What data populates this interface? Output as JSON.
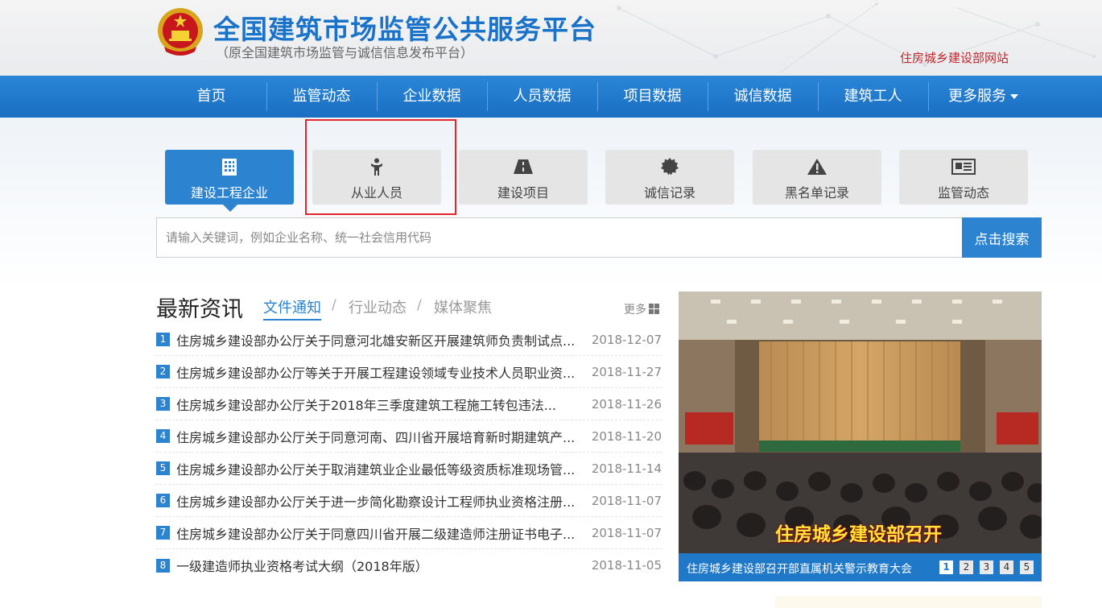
{
  "header": {
    "title": "全国建筑市场监管公共服务平台",
    "subtitle": "（原全国建筑市场监管与诚信信息发布平台）",
    "ministry_link": "住房城乡建设部网站"
  },
  "nav": {
    "items": [
      "首页",
      "监管动态",
      "企业数据",
      "人员数据",
      "项目数据",
      "诚信数据",
      "建筑工人"
    ],
    "more_label": "更多服务"
  },
  "tabs": [
    {
      "label": "建设工程企业",
      "icon": "building-icon",
      "active": true
    },
    {
      "label": "从业人员",
      "icon": "person-icon",
      "active": false
    },
    {
      "label": "建设项目",
      "icon": "road-icon",
      "active": false
    },
    {
      "label": "诚信记录",
      "icon": "badge-icon",
      "active": false
    },
    {
      "label": "黑名单记录",
      "icon": "warning-icon",
      "active": false
    },
    {
      "label": "监管动态",
      "icon": "newspaper-icon",
      "active": false
    }
  ],
  "search": {
    "placeholder": "请输入关键词，例如企业名称、统一社会信用代码",
    "button_label": "点击搜索"
  },
  "news": {
    "heading": "最新资讯",
    "tabs": [
      "文件通知",
      "行业动态",
      "媒体聚焦"
    ],
    "separator": "/",
    "more_label": "更多",
    "items": [
      {
        "num": "1",
        "title": "住房城乡建设部办公厅关于同意河北雄安新区开展建筑师负责制试点...",
        "date": "2018-12-07"
      },
      {
        "num": "2",
        "title": "住房城乡建设部办公厅等关于开展工程建设领域专业技术人员职业资...",
        "date": "2018-11-27"
      },
      {
        "num": "3",
        "title": "住房城乡建设部办公厅关于2018年三季度建筑工程施工转包违法...",
        "date": "2018-11-26"
      },
      {
        "num": "4",
        "title": "住房城乡建设部办公厅关于同意河南、四川省开展培育新时期建筑产...",
        "date": "2018-11-20"
      },
      {
        "num": "5",
        "title": "住房城乡建设部办公厅关于取消建筑业企业最低等级资质标准现场管...",
        "date": "2018-11-14"
      },
      {
        "num": "6",
        "title": "住房城乡建设部办公厅关于进一步简化勘察设计工程师执业资格注册...",
        "date": "2018-11-07"
      },
      {
        "num": "7",
        "title": "住房城乡建设部办公厅关于同意四川省开展二级建造师注册证书电子...",
        "date": "2018-11-07"
      },
      {
        "num": "8",
        "title": "一级建造师执业资格考试大纲（2018年版）",
        "date": "2018-11-05"
      }
    ]
  },
  "slideshow": {
    "overlay_text": "住房城乡建设部召开",
    "caption": "住房城乡建设部召开部直属机关警示教育大会",
    "pages": [
      "1",
      "2",
      "3",
      "4",
      "5"
    ],
    "active_page": "1"
  },
  "colors": {
    "brand_blue": "#2c83d0",
    "nav_blue": "#1f78c8",
    "highlight_red": "#e4262c",
    "ministry_red": "#c5262b"
  }
}
